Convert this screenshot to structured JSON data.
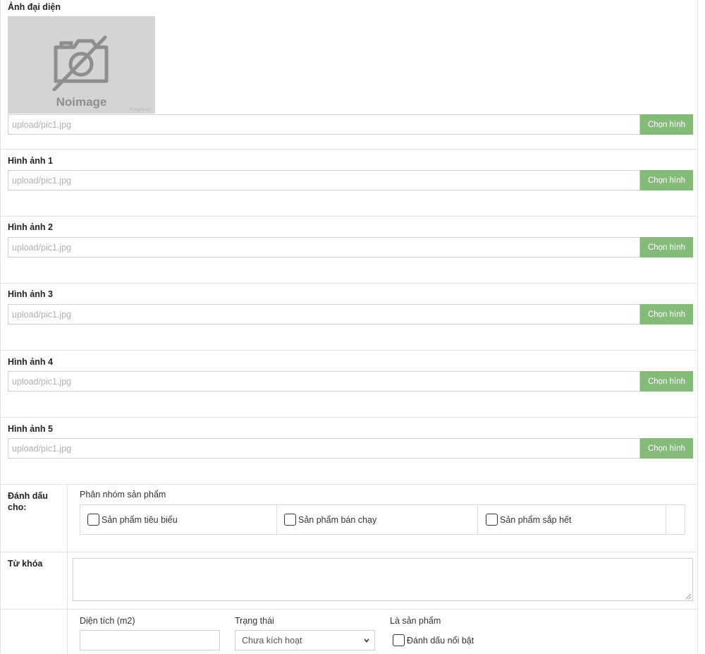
{
  "avatar": {
    "label": "Ảnh đại diện",
    "noimage_text": "Noimage",
    "watermark": "thegioi.vn",
    "path_placeholder": "upload/pic1.jpg",
    "button_label": "Chọn hình"
  },
  "images": [
    {
      "label": "Hình ảnh 1",
      "path_placeholder": "upload/pic1.jpg",
      "button_label": "Chọn hình"
    },
    {
      "label": "Hình ảnh 2",
      "path_placeholder": "upload/pic1.jpg",
      "button_label": "Chọn hình"
    },
    {
      "label": "Hình ảnh 3",
      "path_placeholder": "upload/pic1.jpg",
      "button_label": "Chọn hình"
    },
    {
      "label": "Hình ảnh 4",
      "path_placeholder": "upload/pic1.jpg",
      "button_label": "Chọn hình"
    },
    {
      "label": "Hình ảnh 5",
      "path_placeholder": "upload/pic1.jpg",
      "button_label": "Chọn hình"
    }
  ],
  "mark": {
    "label": "Đánh dấu cho:",
    "group_title": "Phân nhóm sản phẩm",
    "options": [
      "Sản phẩm tiêu biểu",
      "Sản phẩm bán chạy",
      "Sản phẩm sắp hết"
    ]
  },
  "keywords": {
    "label": "Từ khóa"
  },
  "extra": {
    "area_label": "Diện tích (m2)",
    "status_label": "Trạng thái",
    "status_value": "Chưa kích hoạt",
    "product_label": "Là sản phẩm",
    "featured_label": "Đánh dấu nổi bật"
  },
  "colors": {
    "button": "#84bb79",
    "border": "#cfcfcf",
    "placeholder": "#b0b0b0"
  }
}
